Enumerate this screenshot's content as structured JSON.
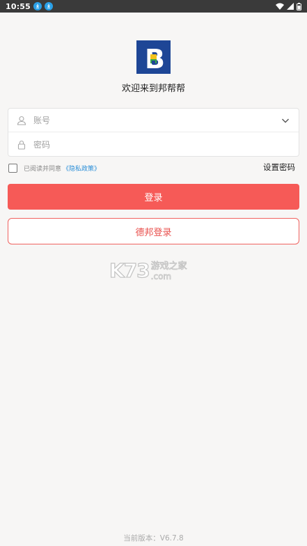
{
  "status_bar": {
    "time": "10:55"
  },
  "brand": {
    "logo_letter": "B",
    "welcome": "欢迎来到邦帮帮",
    "color": "#1e4696"
  },
  "form": {
    "account_placeholder": "账号",
    "password_placeholder": "密码"
  },
  "agreement": {
    "text": "已阅读并同意",
    "link": "《隐私政策》"
  },
  "links": {
    "set_password": "设置密码"
  },
  "buttons": {
    "login": "登录",
    "debang_login": "德邦登录",
    "accent": "#f65a57"
  },
  "watermark": {
    "big": "K73",
    "cn": "游戏之家",
    "com": ".com"
  },
  "footer": {
    "version": "当前版本：V6.7.8"
  }
}
